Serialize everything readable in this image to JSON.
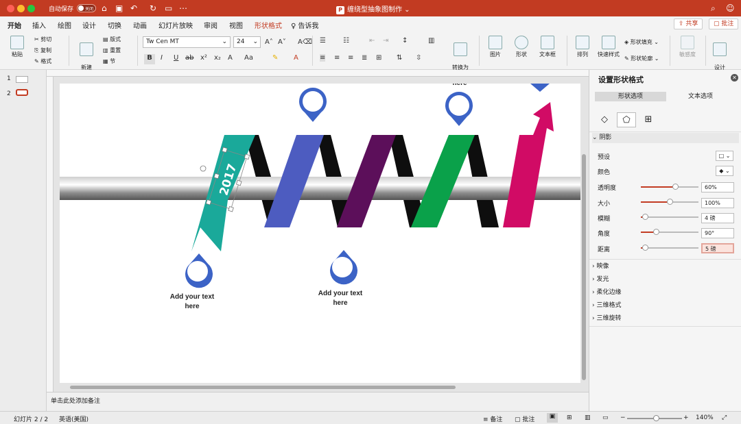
{
  "titlebar": {
    "autosave_label": "自动保存",
    "autosave_state": "关闭",
    "doc_title": "缠绕型抽象图制作"
  },
  "tabs": [
    "开始",
    "插入",
    "绘图",
    "设计",
    "切换",
    "动画",
    "幻灯片放映",
    "审阅",
    "视图",
    "形状格式",
    "告诉我"
  ],
  "share_label": "共享",
  "comment_label": "批注",
  "ribbon": {
    "paste": "粘贴",
    "cut": "剪切",
    "copy": "复制",
    "format": "格式",
    "new_slide": "新建\n幻灯片",
    "layout": "版式",
    "reset": "重置",
    "section": "节",
    "font_name": "Tw Cen MT",
    "font_size": "24",
    "convert_smartart": "转换为\nSmartArt",
    "picture": "图片",
    "shape": "形状",
    "textbox": "文本框",
    "arrange": "排列",
    "quick_styles": "快速样式",
    "shape_fill": "形状填充",
    "shape_outline": "形状轮廓",
    "sensitivity": "敏感度",
    "designer": "设计\n灵感"
  },
  "slides": [
    {
      "num": "1"
    },
    {
      "num": "2"
    }
  ],
  "slide": {
    "year": "2017",
    "text_top": "here",
    "text_left": "Add your text here",
    "text_mid": "Add your text here",
    "ribbon_colors": {
      "teal": "#1aa99a",
      "blue": "#4d5cc0",
      "purple": "#5c0f5a",
      "green": "#0aa14a",
      "magenta": "#d10b65",
      "pin_blue": "#3c63c6"
    }
  },
  "notes_placeholder": "单击此处添加备注",
  "format_panel": {
    "title": "设置形状格式",
    "tab_shape": "形状选项",
    "tab_text": "文本选项",
    "section_shadow": "阴影",
    "props": [
      {
        "label": "预设",
        "kind": "dropdown"
      },
      {
        "label": "颜色",
        "kind": "color"
      },
      {
        "label": "透明度",
        "value": "60%",
        "level": 0.6
      },
      {
        "label": "大小",
        "value": "100%",
        "level": 0.5
      },
      {
        "label": "模糊",
        "value": "4 磅",
        "level": 0.05
      },
      {
        "label": "角度",
        "value": "90°",
        "level": 0.25
      },
      {
        "label": "距离",
        "value": "5 磅",
        "level": 0.05
      }
    ],
    "sections": [
      "映像",
      "发光",
      "柔化边缘",
      "三维格式",
      "三维旋转"
    ]
  },
  "statusbar": {
    "slide_pos": "幻灯片 2 / 2",
    "language": "英语(美国)",
    "notes": "备注",
    "comments": "批注",
    "zoom": "140%"
  }
}
